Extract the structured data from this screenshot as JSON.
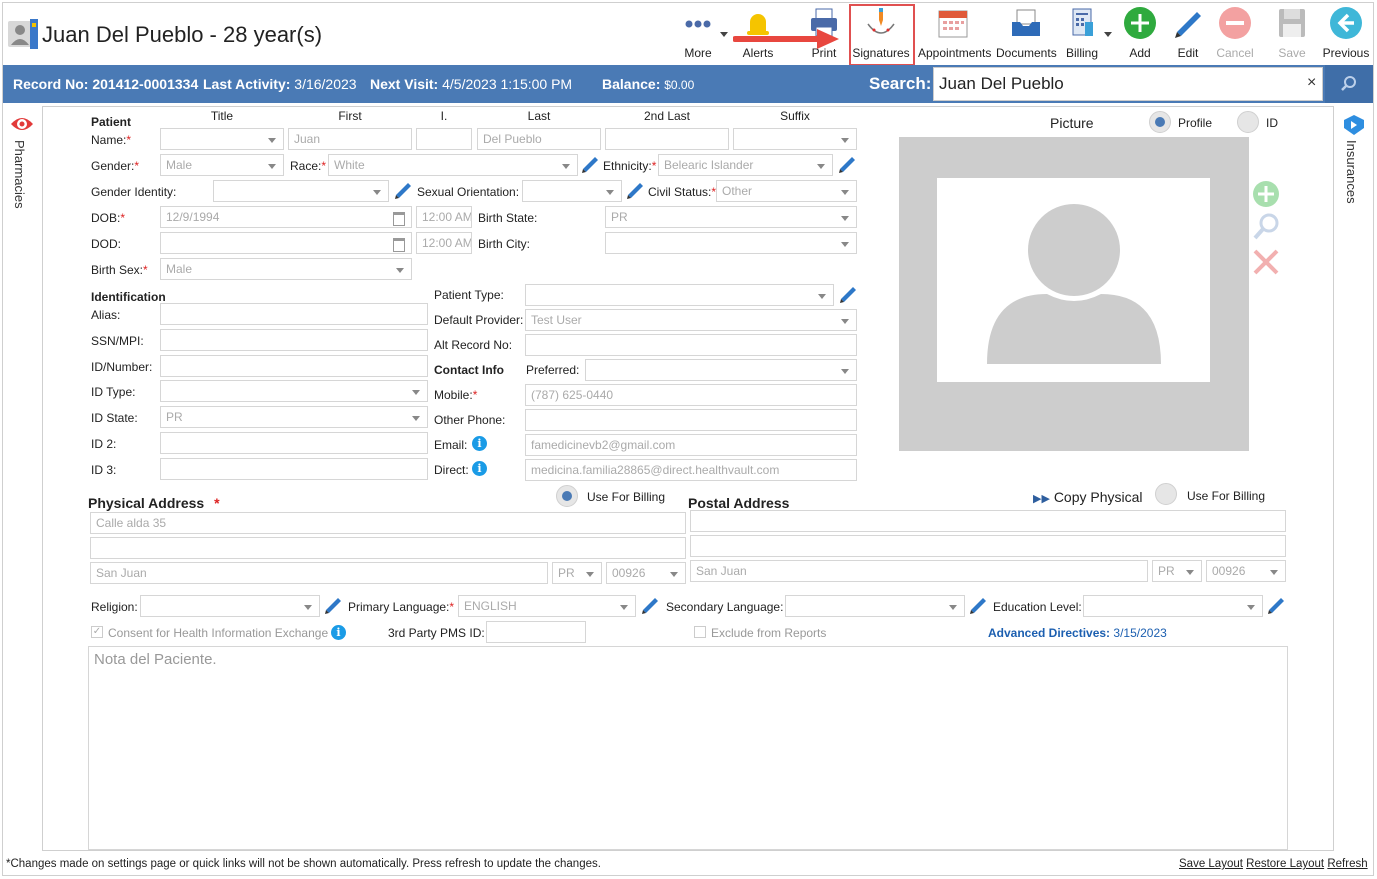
{
  "header": {
    "title": "Juan Del Pueblo - 28 year(s)"
  },
  "toolbar": {
    "more": "More",
    "alerts": "Alerts",
    "print": "Print",
    "signatures": "Signatures",
    "appointments": "Appointments",
    "documents": "Documents",
    "billing": "Billing",
    "add": "Add",
    "edit": "Edit",
    "cancel": "Cancel",
    "save": "Save",
    "previous": "Previous"
  },
  "infobar": {
    "record_label": "Record No:",
    "record_value": "201412-0001334",
    "activity_label": "Last Activity:",
    "activity_value": "3/16/2023",
    "visit_label": "Next Visit:",
    "visit_value": "4/5/2023 1:15:00 PM",
    "balance_label": "Balance:",
    "balance_value": "$0.00",
    "search_label": "Search:",
    "search_value": "Juan Del Pueblo",
    "clear": "×"
  },
  "side": {
    "left": "Pharmacies",
    "right": "Insurances"
  },
  "patient": {
    "section": "Patient",
    "col_title": "Title",
    "col_first": "First",
    "col_i": "I.",
    "col_last": "Last",
    "col_2nd_last": "2nd Last",
    "col_suffix": "Suffix",
    "name_label": "Name:",
    "first": "Juan",
    "last": "Del Pueblo",
    "gender_label": "Gender:",
    "gender": "Male",
    "race_label": "Race:",
    "race": "White",
    "ethnicity_label": "Ethnicity:",
    "ethnicity": "Belearic Islander",
    "gender_identity_label": "Gender Identity:",
    "sexual_orientation_label": "Sexual Orientation:",
    "civil_status_label": "Civil Status:",
    "civil_status": "Other",
    "dob_label": "DOB:",
    "dob": "12/9/1994",
    "dob_time": "12:00 AM",
    "birth_state_label": "Birth State:",
    "birth_state": "PR",
    "dod_label": "DOD:",
    "dod_time": "12:00 AM",
    "birth_city_label": "Birth City:",
    "birth_sex_label": "Birth Sex:",
    "birth_sex": "Male"
  },
  "identification": {
    "section": "Identification",
    "alias_label": "Alias:",
    "ssn_label": "SSN/MPI:",
    "idnum_label": "ID/Number:",
    "idtype_label": "ID Type:",
    "idstate_label": "ID State:",
    "idstate": "PR",
    "id2_label": "ID 2:",
    "id3_label": "ID 3:"
  },
  "contact": {
    "patient_type_label": "Patient Type:",
    "default_provider_label": "Default Provider:",
    "default_provider": "Test User",
    "alt_record_label": "Alt Record No:",
    "section": "Contact Info",
    "preferred_label": "Preferred:",
    "mobile_label": "Mobile:",
    "mobile": "(787) 625-0440",
    "other_phone_label": "Other Phone:",
    "email_label": "Email:",
    "email": "famedicinevb2@gmail.com",
    "direct_label": "Direct:",
    "direct": "medicina.familia28865@direct.healthvault.com"
  },
  "picture": {
    "label": "Picture",
    "profile": "Profile",
    "id": "ID"
  },
  "physical": {
    "title": "Physical Address",
    "use_billing": "Use For Billing",
    "line1": "Calle alda 35",
    "city": "San Juan",
    "state": "PR",
    "zip": "00926"
  },
  "postal": {
    "title": "Postal Address",
    "copy": "Copy Physical",
    "use_billing": "Use For Billing",
    "city": "San Juan",
    "state": "PR",
    "zip": "00926"
  },
  "other": {
    "religion_label": "Religion:",
    "primary_lang_label": "Primary Language:",
    "primary_lang": "ENGLISH",
    "secondary_lang_label": "Secondary Language:",
    "education_label": "Education Level:",
    "consent": "Consent for Health Information Exchange",
    "third_party_label": "3rd Party PMS ID:",
    "exclude": "Exclude from Reports",
    "adv_label": "Advanced Directives:",
    "adv_value": "3/15/2023",
    "note_placeholder": "Nota del Paciente."
  },
  "footer": {
    "note": "*Changes made on settings page or quick links will not be shown automatically. Press refresh to update the changes.",
    "save_layout": "Save Layout",
    "restore_layout": "Restore Layout",
    "refresh": "Refresh"
  }
}
